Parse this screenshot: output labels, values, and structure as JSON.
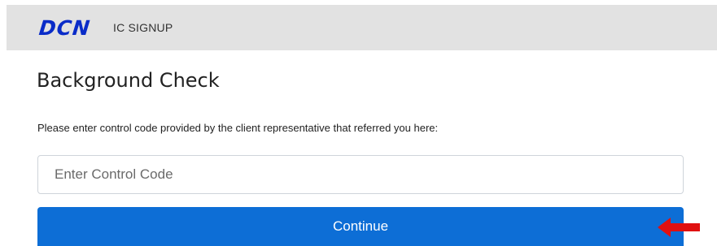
{
  "header": {
    "logo_text": "DCN",
    "subtitle": "IC SIGNUP",
    "background_color": "#e2e2e2",
    "logo_color": "#0a2cc8"
  },
  "main": {
    "title": "Background Check",
    "instructions": "Please enter control code provided by the client representative that referred you here:",
    "control_code": {
      "value": "",
      "placeholder": "Enter Control Code"
    },
    "continue_label": "Continue",
    "button_color": "#0d6ed6"
  },
  "annotation": {
    "icon": "left-arrow-icon",
    "color": "#e01010"
  }
}
